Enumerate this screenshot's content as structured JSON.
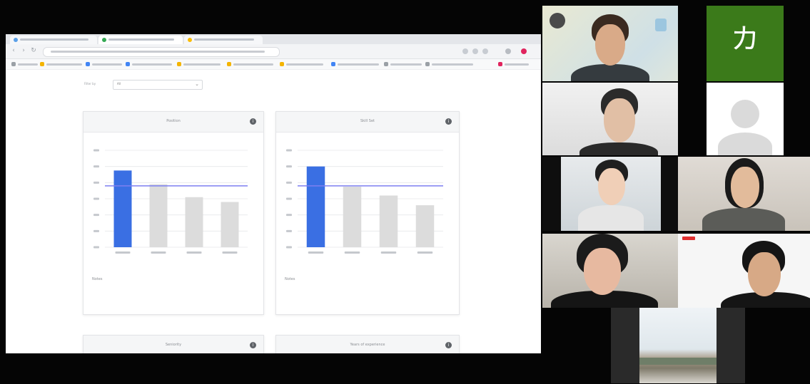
{
  "shared_screen": {
    "filter": {
      "label": "Filter by",
      "value": "All"
    },
    "cards": [
      {
        "title": "Position",
        "notes_title": "Notes",
        "notes_text": "",
        "chart_data": {
          "type": "bar",
          "categories": [
            "",
            "",
            "",
            ""
          ],
          "values": [
            95,
            78,
            62,
            56
          ],
          "reference_line": 76,
          "ylim": [
            0,
            120
          ],
          "highlight_index": 0,
          "colors": {
            "highlight": "#3a6fe3",
            "bar": "#dcdcdc",
            "reference": "#7d7ff0"
          }
        }
      },
      {
        "title": "Skill Set",
        "notes_title": "Notes",
        "notes_text": "",
        "chart_data": {
          "type": "bar",
          "categories": [
            "",
            "",
            "",
            ""
          ],
          "values": [
            100,
            75,
            64,
            52
          ],
          "reference_line": 76,
          "ylim": [
            0,
            120
          ],
          "highlight_index": 0,
          "colors": {
            "highlight": "#3a6fe3",
            "bar": "#dcdcdc",
            "reference": "#7d7ff0"
          }
        }
      },
      {
        "title": "Seniority"
      },
      {
        "title": "Years of experience"
      }
    ]
  },
  "participants": {
    "initial_tile": {
      "initial": "カ",
      "color": "#3b7a1a"
    }
  }
}
